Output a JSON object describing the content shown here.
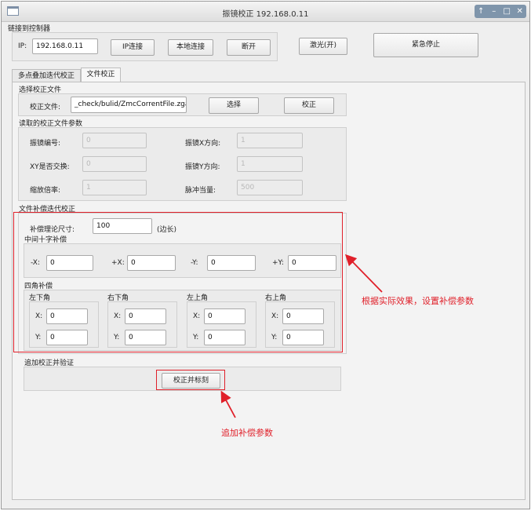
{
  "window": {
    "title": "振镜校正 192.168.0.11",
    "controls": [
      "↑",
      "–",
      "□",
      "✕"
    ]
  },
  "connection": {
    "section_label": "链接到控制器",
    "ip_label": "IP:",
    "ip_value": "192.168.0.11",
    "ip_connect": "IP连接",
    "local_connect": "本地连接",
    "disconnect": "断开",
    "laser": "激光(开)",
    "emergency_stop": "紧急停止"
  },
  "tabs": [
    "多点叠加迭代校正",
    "文件校正"
  ],
  "file_select": {
    "section_label": "选择校正文件",
    "file_label": "校正文件:",
    "file_value": "_check/bulid/ZmcCorrentFile.zga",
    "select_button": "选择",
    "correct_button": "校正"
  },
  "params": {
    "section_label": "读取的校正文件参数",
    "galvo_no_label": "振镜编号:",
    "galvo_no": "0",
    "xy_swap_label": "XY是否交换:",
    "xy_swap": "0",
    "scale_label": "缩放倍率:",
    "scale": "1",
    "x_dir_label": "振镜X方向:",
    "x_dir": "1",
    "y_dir_label": "振镜Y方向:",
    "y_dir": "1",
    "pulse_label": "脉冲当量:",
    "pulse": "500"
  },
  "compensation": {
    "section_label": "文件补偿迭代校正",
    "theory_size_label": "补偿理论尺寸:",
    "theory_size": "100",
    "theory_unit": "(边长)",
    "cross_label": "中间十字补偿",
    "cross": [
      {
        "label": "-X:",
        "value": "0"
      },
      {
        "label": "+X:",
        "value": "0"
      },
      {
        "label": "-Y:",
        "value": "0"
      },
      {
        "label": "+Y:",
        "value": "0"
      }
    ],
    "corner_label": "四角补偿",
    "corners": [
      {
        "title": "左下角",
        "x_label": "X:",
        "x": "0",
        "y_label": "Y:",
        "y": "0"
      },
      {
        "title": "右下角",
        "x_label": "X:",
        "x": "0",
        "y_label": "Y:",
        "y": "0"
      },
      {
        "title": "左上角",
        "x_label": "X:",
        "x": "0",
        "y_label": "Y:",
        "y": "0"
      },
      {
        "title": "右上角",
        "x_label": "X:",
        "x": "0",
        "y_label": "Y:",
        "y": "0"
      }
    ]
  },
  "verify": {
    "section_label": "追加校正并验证",
    "button": "校正并标刻"
  },
  "annotations": {
    "right": "根据实际效果，设置补偿参数",
    "bottom": "追加补偿参数"
  },
  "colors": {
    "annotation_red": "#e0202a"
  }
}
